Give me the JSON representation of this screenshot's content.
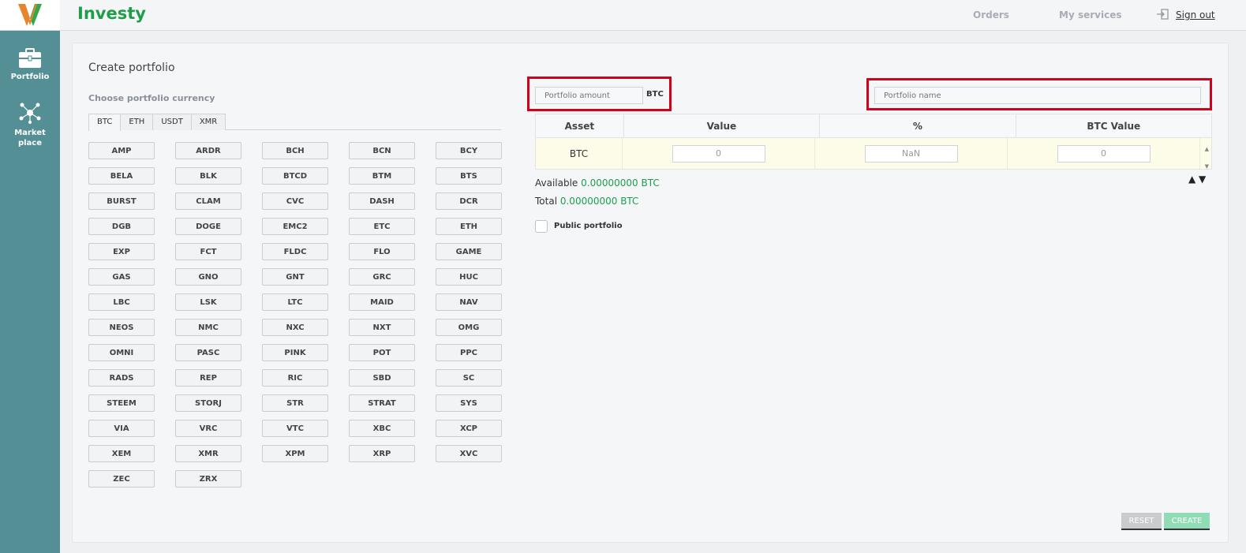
{
  "app": {
    "name": "Investy",
    "logo_icon": "investy-logo-icon"
  },
  "sidebar": {
    "items": [
      {
        "label": "Portfolio",
        "icon": "briefcase-icon"
      },
      {
        "label": "Market place",
        "icon": "network-icon"
      }
    ]
  },
  "header": {
    "orders": "Orders",
    "my_services": "My services",
    "sign_out": "Sign out"
  },
  "page": {
    "title": "Create portfolio",
    "currency_label": "Choose portfolio currency",
    "tabs": [
      "BTC",
      "ETH",
      "USDT",
      "XMR"
    ],
    "active_tab": "BTC",
    "coins": [
      "AMP",
      "ARDR",
      "BCH",
      "BCN",
      "BCY",
      "BELA",
      "BLK",
      "BTCD",
      "BTM",
      "BTS",
      "BURST",
      "CLAM",
      "CVC",
      "DASH",
      "DCR",
      "DGB",
      "DOGE",
      "EMC2",
      "ETC",
      "ETH",
      "EXP",
      "FCT",
      "FLDC",
      "FLO",
      "GAME",
      "GAS",
      "GNO",
      "GNT",
      "GRC",
      "HUC",
      "LBC",
      "LSK",
      "LTC",
      "MAID",
      "NAV",
      "NEOS",
      "NMC",
      "NXC",
      "NXT",
      "OMG",
      "OMNI",
      "PASC",
      "PINK",
      "POT",
      "PPC",
      "RADS",
      "REP",
      "RIC",
      "SBD",
      "SC",
      "STEEM",
      "STORJ",
      "STR",
      "STRAT",
      "SYS",
      "VIA",
      "VRC",
      "VTC",
      "XBC",
      "XCP",
      "XEM",
      "XMR",
      "XPM",
      "XRP",
      "XVC",
      "ZEC",
      "ZRX"
    ]
  },
  "form": {
    "amount_placeholder": "Portfolio amount",
    "amount_unit": "BTC",
    "name_placeholder": "Portfolio name"
  },
  "table": {
    "headers": [
      "Asset",
      "Value",
      "%",
      "BTC Value"
    ],
    "rows": [
      {
        "asset": "BTC",
        "value": "0",
        "percent": "NaN",
        "btc_value": "0"
      }
    ],
    "sort_arrows": "▲ ▼"
  },
  "summary": {
    "available_label": "Available",
    "available_value": "0.00000000 BTC",
    "total_label": "Total",
    "total_value": "0.00000000 BTC"
  },
  "public_portfolio_label": "Public portfolio",
  "buttons": {
    "reset": "RESET",
    "create": "CREATE"
  },
  "colors": {
    "sidebar": "#558f96",
    "brand": "#1e9e4a",
    "highlight": "#d0021b"
  }
}
